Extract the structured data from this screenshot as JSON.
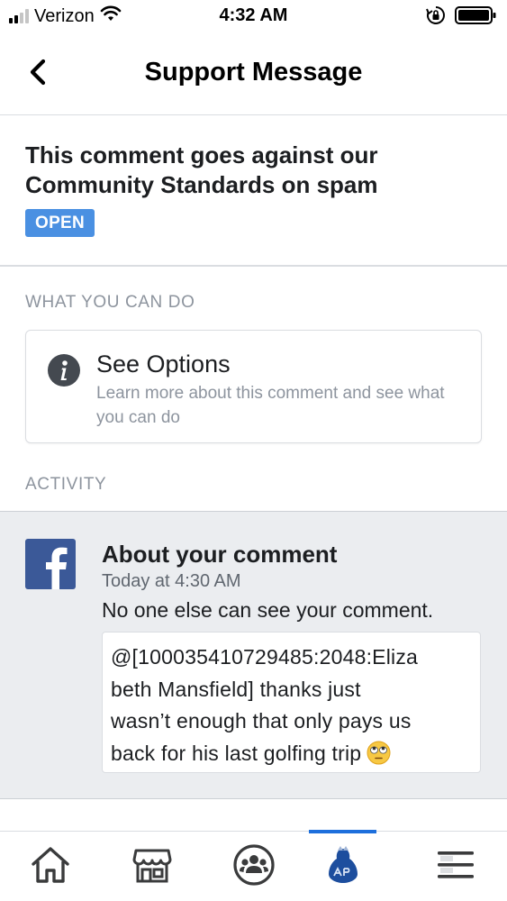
{
  "status_bar": {
    "carrier": "Verizon",
    "time": "4:32 AM"
  },
  "header": {
    "title": "Support Message"
  },
  "summary": {
    "title": "This comment goes against our Community Standards on spam",
    "status": "OPEN",
    "status_color": "#4a90e2"
  },
  "what_you_can_do": {
    "label": "WHAT YOU CAN DO",
    "card_title": "See Options",
    "card_desc": "Learn more about this comment and see what you can do",
    "icon": "info-icon"
  },
  "activity": {
    "label": "ACTIVITY",
    "title": "About your comment",
    "time": "Today at 4:30 AM",
    "description": "No one else can see your comment.",
    "comment_lines": [
      "@[100035410729485:2048:Eliza",
      "beth Mansfield] thanks just",
      "wasn’t enough that only pays us",
      "back for his last golfing trip"
    ],
    "icon": "facebook-logo-icon"
  },
  "tabs": [
    {
      "name": "tab-home",
      "icon": "home-icon"
    },
    {
      "name": "tab-marketplace",
      "icon": "marketplace-icon"
    },
    {
      "name": "tab-groups",
      "icon": "groups-icon"
    },
    {
      "name": "tab-profile",
      "icon": "profile-icon",
      "active": true
    },
    {
      "name": "tab-menu",
      "icon": "menu-icon"
    }
  ],
  "colors": {
    "brand": "#3b5998",
    "accent": "#1d6fdc",
    "muted_text": "#8d949e"
  }
}
